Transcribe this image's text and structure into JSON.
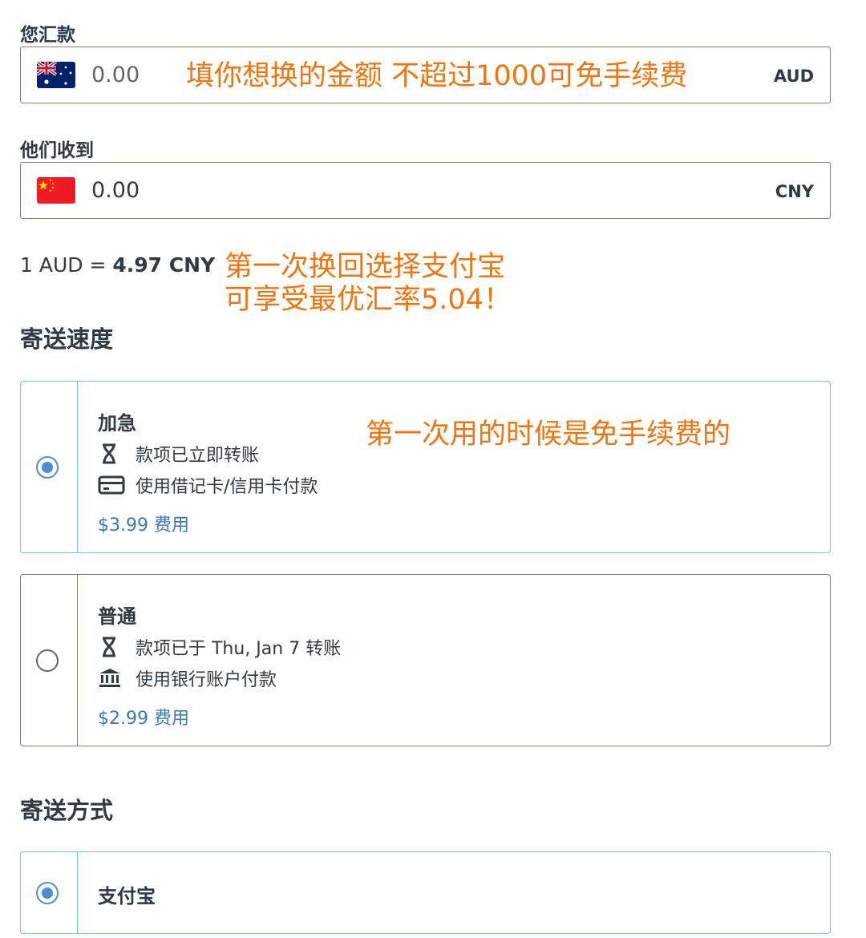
{
  "send": {
    "label": "您汇款",
    "amount": "0.00",
    "currency": "AUD",
    "flag": "australia-flag"
  },
  "receive": {
    "label": "他们收到",
    "amount": "0.00",
    "currency": "CNY",
    "flag": "china-flag"
  },
  "rate": {
    "prefix": "1 AUD = ",
    "value": "4.97 CNY"
  },
  "annotations": {
    "amount_note": "填你想换的金额 不超过1000可免手续费",
    "rate_note_line1": "第一次换回选择支付宝",
    "rate_note_line2": "可享受最优汇率5.04！",
    "fee_note": "第一次用的时候是免手续费的",
    "color": "#f07410"
  },
  "speed": {
    "title": "寄送速度",
    "options": [
      {
        "title": "加急",
        "selected": true,
        "line1": "款项已立即转账",
        "line1_icon": "hourglass-icon",
        "line2": "使用借记卡/信用卡付款",
        "line2_icon": "credit-card-icon",
        "fee": "$3.99 费用"
      },
      {
        "title": "普通",
        "selected": false,
        "line1": "款项已于 Thu, Jan 7 转账",
        "line1_icon": "hourglass-icon",
        "line2": "使用银行账户付款",
        "line2_icon": "bank-icon",
        "fee": "$2.99 费用"
      }
    ]
  },
  "method": {
    "title": "寄送方式",
    "options": [
      {
        "title": "支付宝",
        "selected": true
      }
    ]
  },
  "colors": {
    "accent_blue": "#4a8fd1",
    "selected_border": "#6fc7d9",
    "fee_text": "#3b7ab8",
    "text": "#2e3a45"
  }
}
